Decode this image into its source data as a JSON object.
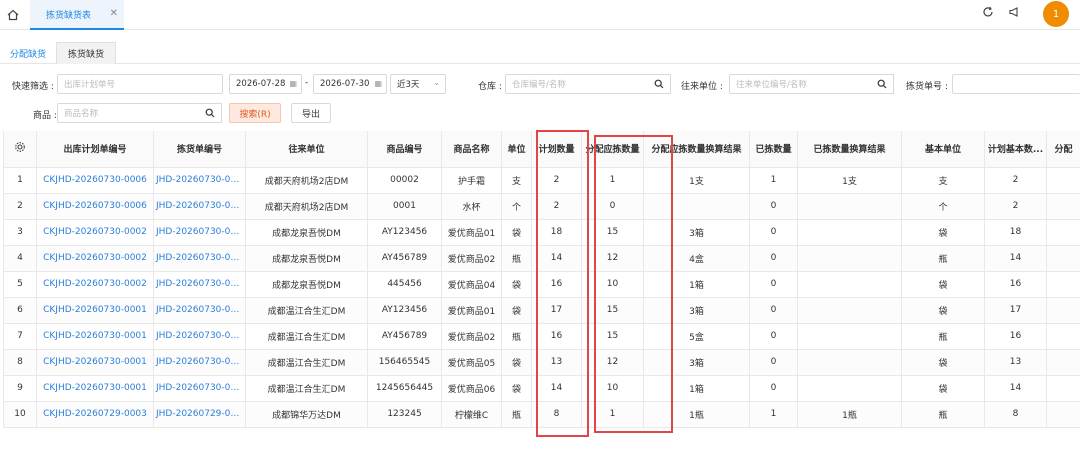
{
  "topbar": {
    "tab_label": "拣货缺货表",
    "tab_close": "✕",
    "avatar_text": "1"
  },
  "subtabs": {
    "active": "分配缺货",
    "inactive": "拣货缺货"
  },
  "filters": {
    "quick_label": "快速筛选 :",
    "plan_no_placeholder": "出库计划单号",
    "date_start": "2026-07-28",
    "date_sep": "-",
    "date_end": "2026-07-30",
    "range": "近3天",
    "warehouse_label": "仓库 :",
    "warehouse_placeholder": "仓库编号/名称",
    "partner_label": "往来单位 :",
    "partner_placeholder": "往来单位编号/名称",
    "pick_no_label": "拣货单号 :",
    "goods_label": "商品 :",
    "goods_placeholder": "商品名称",
    "search_btn": "搜索(R)",
    "export_btn": "导出"
  },
  "table": {
    "headers": [
      "",
      "出库计划单编号",
      "拣货单编号",
      "往来单位",
      "商品编号",
      "商品名称",
      "单位",
      "计划数量",
      "分配应拣数量",
      "分配应拣数量换算结果",
      "已拣数量",
      "已拣数量换算结果",
      "基本单位",
      "计划基本数...",
      "分配"
    ],
    "rows": [
      [
        "1",
        "CKJHD-20260730-0006",
        "JHD-20260730-00...",
        "成都天府机场2店DM",
        "00002",
        "护手霜",
        "支",
        "2",
        "1",
        "1支",
        "1",
        "1支",
        "支",
        "2",
        ""
      ],
      [
        "2",
        "CKJHD-20260730-0006",
        "JHD-20260730-00...",
        "成都天府机场2店DM",
        "0001",
        "水杯",
        "个",
        "2",
        "0",
        "",
        "0",
        "",
        "个",
        "2",
        ""
      ],
      [
        "3",
        "CKJHD-20260730-0002",
        "JHD-20260730-00...",
        "成都龙泉吾悦DM",
        "AY123456",
        "爱优商品01",
        "袋",
        "18",
        "15",
        "3箱",
        "0",
        "",
        "袋",
        "18",
        ""
      ],
      [
        "4",
        "CKJHD-20260730-0002",
        "JHD-20260730-00...",
        "成都龙泉吾悦DM",
        "AY456789",
        "爱优商品02",
        "瓶",
        "14",
        "12",
        "4盒",
        "0",
        "",
        "瓶",
        "14",
        ""
      ],
      [
        "5",
        "CKJHD-20260730-0002",
        "JHD-20260730-00...",
        "成都龙泉吾悦DM",
        "445456",
        "爱优商品04",
        "袋",
        "16",
        "10",
        "1箱",
        "0",
        "",
        "袋",
        "16",
        ""
      ],
      [
        "6",
        "CKJHD-20260730-0001",
        "JHD-20260730-00...",
        "成都温江合生汇DM",
        "AY123456",
        "爱优商品01",
        "袋",
        "17",
        "15",
        "3箱",
        "0",
        "",
        "袋",
        "17",
        ""
      ],
      [
        "7",
        "CKJHD-20260730-0001",
        "JHD-20260730-00...",
        "成都温江合生汇DM",
        "AY456789",
        "爱优商品02",
        "瓶",
        "16",
        "15",
        "5盒",
        "0",
        "",
        "瓶",
        "16",
        ""
      ],
      [
        "8",
        "CKJHD-20260730-0001",
        "JHD-20260730-00...",
        "成都温江合生汇DM",
        "156465545",
        "爱优商品05",
        "袋",
        "13",
        "12",
        "3箱",
        "0",
        "",
        "袋",
        "13",
        ""
      ],
      [
        "9",
        "CKJHD-20260730-0001",
        "JHD-20260730-00...",
        "成都温江合生汇DM",
        "1245656445",
        "爱优商品06",
        "袋",
        "14",
        "10",
        "1箱",
        "0",
        "",
        "袋",
        "14",
        ""
      ],
      [
        "10",
        "CKJHD-20260729-0003",
        "JHD-20260729-00...",
        "成都锦华万达DM",
        "123245",
        "柠檬维C",
        "瓶",
        "8",
        "1",
        "1瓶",
        "1",
        "1瓶",
        "瓶",
        "8",
        ""
      ]
    ]
  },
  "colors": {
    "accent": "#1e88e5",
    "link": "#2b7fd8",
    "highlight": "#e04646",
    "search_btn": "#e05a1c",
    "avatar": "#f08c00"
  }
}
